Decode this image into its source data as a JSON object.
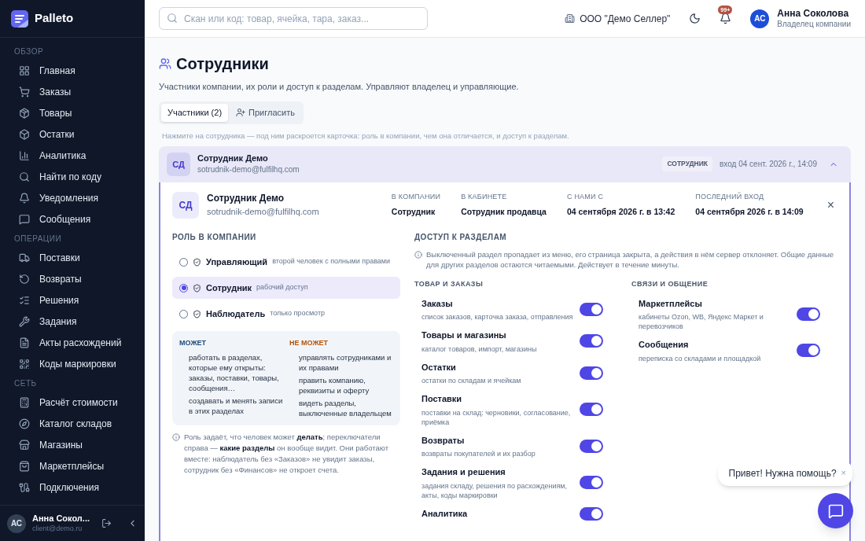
{
  "brand": {
    "logo_name": "Palleto"
  },
  "sidebar": {
    "sections": [
      {
        "title": "ОБЗОР",
        "items": [
          {
            "label": "Главная"
          },
          {
            "label": "Заказы"
          },
          {
            "label": "Товары"
          },
          {
            "label": "Остатки"
          },
          {
            "label": "Аналитика"
          },
          {
            "label": "Найти по коду"
          },
          {
            "label": "Уведомления"
          },
          {
            "label": "Сообщения"
          }
        ]
      },
      {
        "title": "ОПЕРАЦИИ",
        "items": [
          {
            "label": "Поставки"
          },
          {
            "label": "Возвраты"
          },
          {
            "label": "Решения"
          },
          {
            "label": "Задания"
          },
          {
            "label": "Акты расхождений"
          },
          {
            "label": "Коды маркировки"
          }
        ]
      },
      {
        "title": "СЕТЬ",
        "items": [
          {
            "label": "Расчёт стоимости"
          },
          {
            "label": "Каталог складов"
          },
          {
            "label": "Магазины"
          },
          {
            "label": "Маркетплейсы"
          },
          {
            "label": "Подключения"
          }
        ]
      }
    ],
    "user": {
      "initials": "АС",
      "name": "Анна Сокол...",
      "email": "client@demo.ru"
    }
  },
  "header": {
    "search": {
      "placeholder": "Скан или код: товар, ячейка, тара, заказ..."
    },
    "company": "ООО \"Демо Селлер\"",
    "notifications_badge": "99+",
    "user": {
      "initials": "АС",
      "name": "Анна Соколова",
      "role": "Владелец компании"
    }
  },
  "page": {
    "title": "Сотрудники",
    "subtitle": "Участники компании, их роли и доступ к разделам. Управляют владелец и управляющие.",
    "tabs": [
      {
        "label": "Участники (2)",
        "selected": true
      },
      {
        "label": "Пригласить",
        "selected": false
      }
    ],
    "hint": "Нажмите на сотрудника — под ним раскроется карточка: роль в компании, чем она отличается, и доступ к разделам."
  },
  "member": {
    "initials": "СД",
    "name": "Сотрудник Демо",
    "email": "sotrudnik-demo@fulfilhq.com",
    "badge": "СОТРУДНИК",
    "last_login": "вход 04 сент. 2026 г., 14:09",
    "expanded": true
  },
  "card": {
    "initials": "СД",
    "name": "Сотрудник Демо",
    "email": "sotrudnik-demo@fulfilhq.com",
    "meta": [
      {
        "label": "В КОМПАНИИ",
        "value": "Сотрудник"
      },
      {
        "label": "В КАБИНЕТЕ",
        "value": "Сотрудник продавца"
      },
      {
        "label": "С НАМИ С",
        "value": "04 сентября 2026 г. в 13:42"
      },
      {
        "label": "ПОСЛЕДНИЙ ВХОД",
        "value": "04 сентября 2026 г. в 14:09"
      }
    ],
    "close": "×",
    "role": {
      "title": "РОЛЬ В КОМПАНИИ",
      "options": [
        {
          "name": "Управляющий",
          "desc": "второй человек с полными правами",
          "selected": false
        },
        {
          "name": "Сотрудник",
          "desc": "рабочий доступ",
          "selected": true
        },
        {
          "name": "Наблюдатель",
          "desc": "только просмотр",
          "selected": false
        }
      ],
      "can": {
        "title": "МОЖЕТ",
        "items": [
          "работать в разделах, которые ему открыты: заказы, поставки, товары, сообщения…",
          "создавать и менять записи в этих разделах"
        ]
      },
      "cannot": {
        "title": "НЕ МОЖЕТ",
        "items": [
          "управлять сотрудниками и их правами",
          "править компанию, реквизиты и оферту",
          "видеть разделы, выключенные владельцем"
        ]
      },
      "note": "Роль задаёт, что человек может **делать**; переключатели справа — **какие разделы** он вообще видит. Они работают вместе: наблюдатель без «Заказов» не увидит заказы, сотрудник без «Финансов» не откроет счета."
    },
    "access": {
      "title": "ДОСТУП К РАЗДЕЛАМ",
      "note": "Выключенный раздел пропадает из меню, его страница закрыта, а действия в нём сервер отклоняет. Общие данные для других разделов остаются читаемыми. Действует в течение минуты.",
      "groups": [
        {
          "title": "ТОВАР И ЗАКАЗЫ",
          "items": [
            {
              "name": "Заказы",
              "desc": "список заказов, карточка заказа, отправления",
              "on": true
            },
            {
              "name": "Товары и магазины",
              "desc": "каталог товаров, импорт, магазины",
              "on": true
            },
            {
              "name": "Остатки",
              "desc": "остатки по складам и ячейкам",
              "on": true
            },
            {
              "name": "Поставки",
              "desc": "поставки на склад: черновики, согласование, приёмка",
              "on": true
            },
            {
              "name": "Возвраты",
              "desc": "возвраты покупателей и их разбор",
              "on": true
            },
            {
              "name": "Задания и решения",
              "desc": "задания складу, решения по расхождениям, акты, коды маркировки",
              "on": true
            },
            {
              "name": "Аналитика",
              "on": true
            }
          ]
        },
        {
          "title": "СВЯЗИ И ОБЩЕНИЕ",
          "items": [
            {
              "name": "Маркетплейсы",
              "desc": "кабинеты Ozon, WB, Яндекс Маркет и перевозчиков",
              "on": true
            },
            {
              "name": "Сообщения",
              "desc": "переписка со складами и площадкой",
              "on": true
            }
          ]
        }
      ]
    }
  },
  "chat": {
    "greeting": "Привет! Нужна помощь?",
    "close": "×"
  }
}
